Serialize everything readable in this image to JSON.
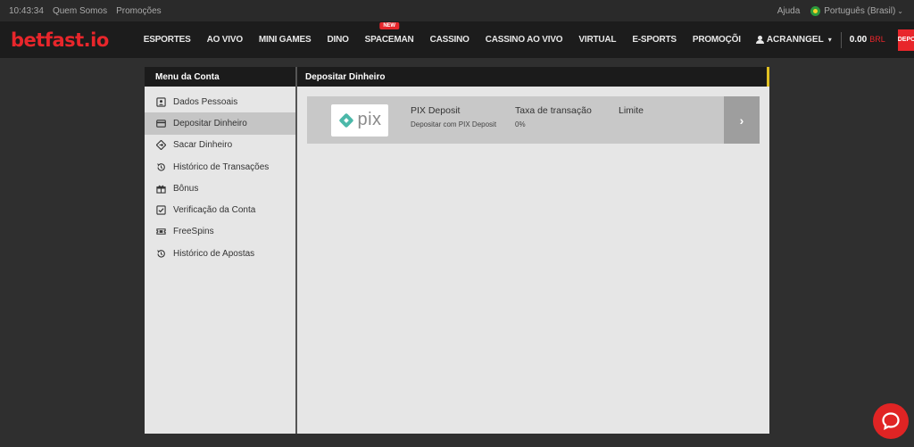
{
  "topbar": {
    "time": "10:43:34",
    "links": [
      "Quem Somos",
      "Promoções"
    ],
    "help": "Ajuda",
    "language": "Português (Brasil)"
  },
  "nav": {
    "logo": "betfast.io",
    "items": [
      "ESPORTES",
      "AO VIVO",
      "MINI GAMES",
      "DINO",
      "SPACEMAN",
      "CASSINO",
      "CASSINO AO VIVO",
      "VIRTUAL",
      "E-SPORTS",
      "PROMOÇÕI"
    ],
    "new_badge": "NEW",
    "username": "ACRANNGEL",
    "balance": "0.00",
    "currency": "BRL",
    "deposit_label": "DEPOSITAR"
  },
  "sidebar": {
    "title": "Menu da Conta",
    "items": [
      {
        "label": "Dados Pessoais",
        "icon": "id-card-icon"
      },
      {
        "label": "Depositar Dinheiro",
        "icon": "card-icon"
      },
      {
        "label": "Sacar Dinheiro",
        "icon": "withdraw-icon"
      },
      {
        "label": "Histórico de Transações",
        "icon": "history-icon"
      },
      {
        "label": "Bônus",
        "icon": "gift-icon"
      },
      {
        "label": "Verificação da Conta",
        "icon": "checkbox-icon"
      },
      {
        "label": "FreeSpins",
        "icon": "ticket-icon"
      },
      {
        "label": "Histórico de Apostas",
        "icon": "history-icon"
      }
    ],
    "active_index": 1
  },
  "content": {
    "title": "Depositar Dinheiro",
    "method": {
      "logo_text": "pix",
      "name": "PIX Deposit",
      "description": "Depositar com PIX Deposit",
      "fee_label": "Taxa de transação",
      "fee_value": "0%",
      "limit_label": "Limite"
    }
  },
  "colors": {
    "accent_red": "#e8262b",
    "pix_teal": "#4bb8a9",
    "header_yellow": "#e0c022"
  }
}
